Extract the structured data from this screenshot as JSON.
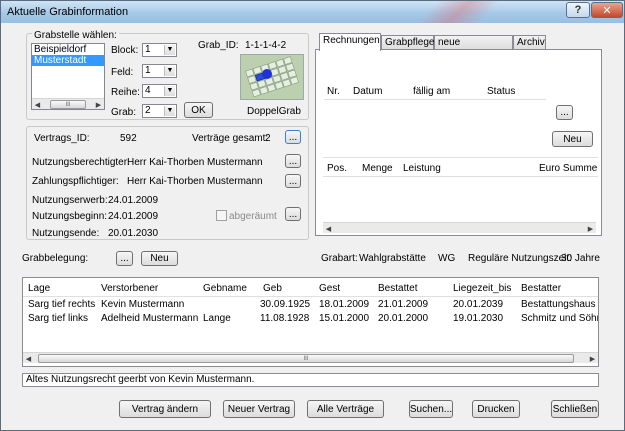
{
  "window": {
    "title": "Aktuelle Grabinformation",
    "help_label": "?",
    "close_label": "✕"
  },
  "grabstelle": {
    "group_label": "Grabstelle wählen:",
    "cemeteries": [
      "Beispieldorf",
      "Musterstadt"
    ],
    "selected_cemetery": "Musterstadt",
    "block_label": "Block:",
    "block_value": "1",
    "feld_label": "Feld:",
    "feld_value": "1",
    "reihe_label": "Reihe:",
    "reihe_value": "4",
    "grab_label": "Grab:",
    "grab_value": "2",
    "ok_label": "OK",
    "grab_id_label": "Grab_ID:",
    "grab_id_value": "1-1-1-4-2",
    "grab_type": "DoppelGrab",
    "scroll_thumb": "III"
  },
  "vertrag": {
    "vertrags_id_label": "Vertrags_ID:",
    "vertrags_id_value": "592",
    "vertraege_gesamt_label": "Verträge gesamt:",
    "vertraege_gesamt_value": "2",
    "more_label": "...",
    "nutzungsberechtigter_label": "Nutzungsberechtigter:",
    "nutzungsberechtigter_value": "Herr  Kai-Thorben Mustermann",
    "zahlungspflichtiger_label": "Zahlungspflichtiger:",
    "zahlungspflichtiger_value": "Herr  Kai-Thorben Mustermann",
    "nutzungserwerb_label": "Nutzungserwerb:",
    "nutzungserwerb_value": "24.01.2009",
    "nutzungsbeginn_label": "Nutzungsbeginn:",
    "nutzungsbeginn_value": "24.01.2009",
    "nutzungsende_label": "Nutzungsende:",
    "nutzungsende_value": "20.01.2030",
    "abgeraeumt_label": "abgeräumt"
  },
  "tabs": {
    "items": [
      "Rechnungen",
      "Grabpflege",
      "neue Dokumente",
      "Archiv"
    ],
    "active": "Rechnungen",
    "invoice_columns": [
      "Nr.",
      "Datum",
      "fällig am",
      "Status"
    ],
    "more_label": "...",
    "neu_label": "Neu",
    "position_columns": [
      "Pos.",
      "Menge",
      "Leistung",
      "Euro Summe"
    ]
  },
  "grabbelegung": {
    "label": "Grabbelegung:",
    "more_label": "...",
    "neu_label": "Neu",
    "grabart_label": "Grabart:",
    "grabart_value": "Wahlgrabstätte",
    "grabart_code": "WG",
    "nutzungszeit_label": "Reguläre Nutzungszeit:",
    "nutzungszeit_value": "30 Jahre"
  },
  "burials": {
    "columns": [
      "Lage",
      "Verstorbener",
      "Gebname",
      "Geb",
      "Gest",
      "Bestattet",
      "Liegezeit_bis",
      "Bestatter"
    ],
    "rows": [
      [
        "Sarg tief rechts",
        "Kevin Mustermann",
        "",
        "30.09.1925",
        "18.01.2009",
        "21.01.2009",
        "20.01.2039",
        "Bestattungshaus Me"
      ],
      [
        "Sarg tief links",
        "Adelheid Mustermann",
        "Lange",
        "11.08.1928",
        "15.01.2000",
        "20.01.2000",
        "19.01.2030",
        "Schmitz und Söhne"
      ]
    ],
    "scroll_thumb": "III"
  },
  "status_text": "Altes Nutzungsrecht geerbt von Kevin Mustermann.",
  "buttons": {
    "vertrag_aendern": "Vertrag ändern",
    "neuer_vertrag": "Neuer Vertrag",
    "alle_vertraege": "Alle Verträge",
    "suchen": "Suchen...",
    "drucken": "Drucken",
    "schliessen": "Schließen"
  }
}
